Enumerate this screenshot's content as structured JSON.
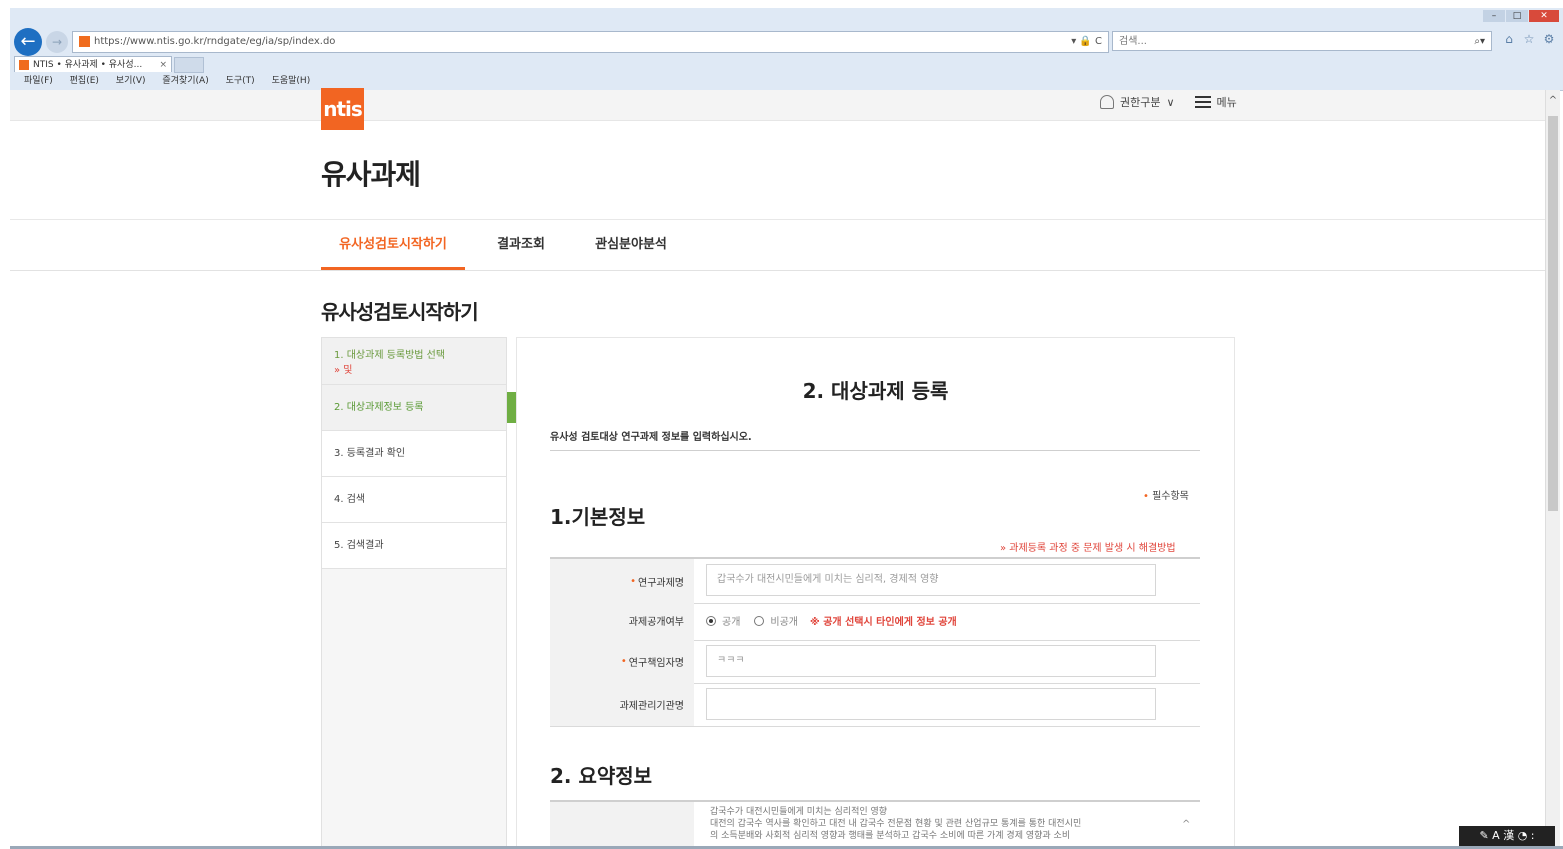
{
  "browser": {
    "url": "https://www.ntis.go.kr/rndgate/eg/ia/sp/index.do",
    "url_tools": "▾ 🔒 C",
    "search_placeholder": "검색...",
    "search_icon": "search-icon",
    "tab_title": "NTIS • 유사과제 • 유사성...",
    "tab_close": "×",
    "menu": [
      "파일(F)",
      "편집(E)",
      "보기(V)",
      "즐겨찾기(A)",
      "도구(T)",
      "도움말(H)"
    ],
    "window_controls": [
      "–",
      "□",
      "✕"
    ]
  },
  "site": {
    "logo_text": "ntis",
    "user_label": "권한구분",
    "user_caret": "∨",
    "menu_label": "메뉴",
    "accent_color": "#f26522"
  },
  "page": {
    "title": "유사과제",
    "tabs": [
      "유사성검토시작하기",
      "결과조회",
      "관심분야분석"
    ],
    "active_tab": 0,
    "section_title": "유사성검토시작하기"
  },
  "steps": [
    {
      "label": "1. 대상과제 등록방법 선택",
      "sub": "» 및"
    },
    {
      "label": "2. 대상과제정보 등록"
    },
    {
      "label": "3. 등록결과 확인"
    },
    {
      "label": "4. 검색"
    },
    {
      "label": "5. 검색결과"
    }
  ],
  "panel": {
    "title": "2. 대상과제 등록",
    "intro": "유사성 검토대상 연구과제 정보를 입력하십시오.",
    "required_note": "필수항목",
    "basic_title": "1.기본정보",
    "help_link": "» 과제등록 과정 중 문제 발생 시 해결방법",
    "summary_title": "2. 요약정보"
  },
  "form": {
    "rows": [
      {
        "label": "연구과제명",
        "required": true,
        "value": "갑국수가 대전시민들에게 미치는 심리적, 경제적 영향"
      },
      {
        "label": "과제공개여부",
        "required": false
      },
      {
        "label": "연구책임자명",
        "required": true,
        "value": "ㅋㅋㅋ"
      },
      {
        "label": "과제관리기관명",
        "required": false,
        "value": ""
      }
    ],
    "radio_public": "공개",
    "radio_private": "비공개",
    "radio_selected": "공개",
    "radio_note": "※ 공개 선택시 타인에게 정보 공개"
  },
  "summary": {
    "lines": [
      "갑국수가 대전시민들에게 미치는 심리적인 영향",
      "대전의 갑국수 역사를 확인하고 대전 내 갑국수 전문점 현황 및 관련 산업규모 통계를 통한 대전시민",
      "의 소득분배와 사회적 심리적 영향과 행태를 분석하고 갑국수 소비에 따른 가계 경제 영향과 소비"
    ],
    "scroll_icon": "^"
  },
  "ime": "✎ A 漢 ◔ :"
}
